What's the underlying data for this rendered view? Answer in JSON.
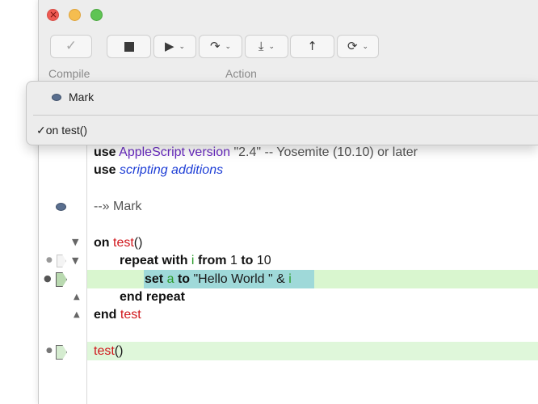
{
  "toolbar": {
    "compile_label": "Compile",
    "action_label": "Action",
    "buttons": {
      "compile": "check-icon",
      "stop": "stop-icon",
      "run": "play-icon",
      "step_over": "step-over-icon",
      "step_into": "step-into-icon",
      "step_out": "step-out-icon",
      "reload": "loop-icon"
    }
  },
  "popup": {
    "mark_label": "Mark",
    "handler_label": "on test()",
    "checkmark": "✓"
  },
  "code": {
    "line1": {
      "kw": "use",
      "app": "AppleScript",
      "version_kw": "version",
      "rest": " \"2.4\" -- Yosemite (10.10) or later"
    },
    "line2": {
      "kw": "use",
      "rest": "scripting additions"
    },
    "line3": "--» Mark",
    "line4": {
      "kw": "on",
      "name": "test",
      "parens": "()"
    },
    "line5": {
      "kw1": "repeat with",
      "var": "i",
      "kw2": "from",
      "n1": "1",
      "kw3": "to",
      "n2": "10"
    },
    "line6": {
      "kw1": "set",
      "var": "a",
      "kw2": "to",
      "str": "\"Hello World \"",
      "amp": "&",
      "var2": "i"
    },
    "line7": {
      "kw": "end repeat"
    },
    "line8": {
      "kw": "end",
      "name": "test"
    },
    "line9": {
      "name": "test",
      "parens": "()"
    }
  },
  "colors": {
    "keyword": "#111111",
    "handler": "#d0161b",
    "variable": "#2b9c2b",
    "application": "#6a2bc2",
    "scripting_additions": "#1f3fd6",
    "current_line_highlight": "#d9f6cf",
    "selection": "#9fd9d9"
  }
}
